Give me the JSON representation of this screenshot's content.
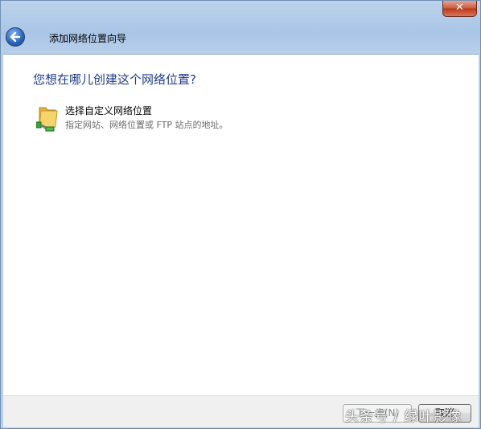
{
  "window": {
    "title": "添加网络位置向导",
    "close_label": "✕"
  },
  "content": {
    "heading": "您想在哪儿创建这个网络位置?",
    "option": {
      "title": "选择自定义网络位置",
      "description": "指定网站、网络位置或 FTP 站点的地址。",
      "icon": "folder-network-icon"
    }
  },
  "footer": {
    "next_label": "下一步(N)",
    "cancel_label": "取消"
  },
  "watermark": "头条号 / 绿叶影像",
  "colors": {
    "heading": "#1f3b8a",
    "description": "#6d6d6d",
    "titlebar": "#a9c5e6",
    "close_button": "#c75a3e"
  }
}
